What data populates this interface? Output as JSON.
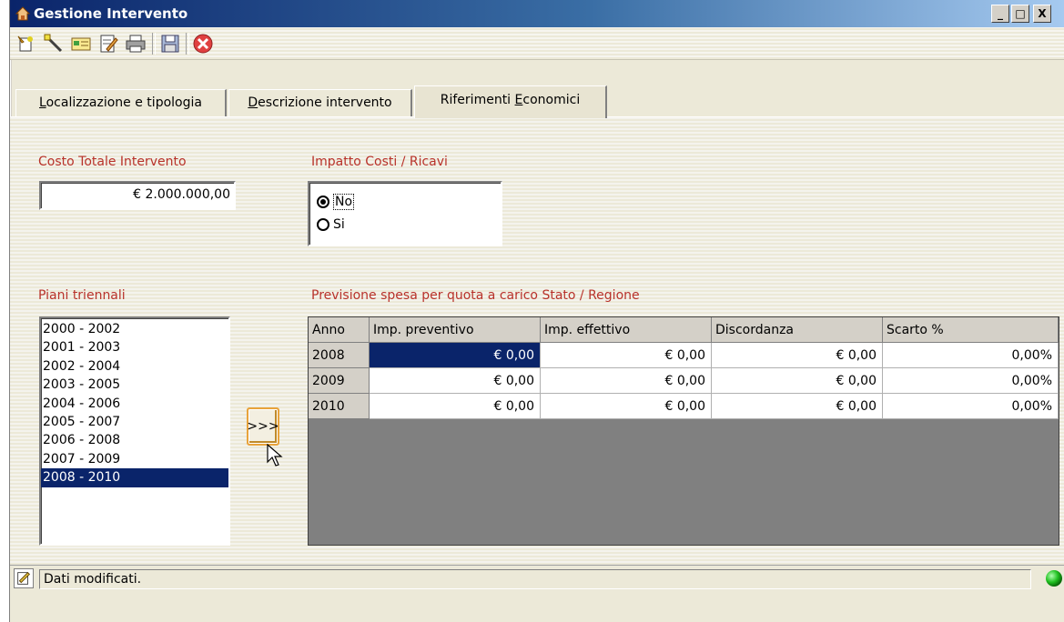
{
  "window": {
    "title": "Gestione Intervento",
    "min_label": "_",
    "max_label": "□",
    "close_label": "X"
  },
  "toolbar": {
    "icons": [
      "new-icon",
      "wand-icon",
      "card-icon",
      "edit-icon",
      "print-icon",
      "save-icon",
      "cancel-icon"
    ]
  },
  "tabs": [
    {
      "label_pre": "",
      "label_ul": "L",
      "label_post": "ocalizzazione e tipologia",
      "active": false
    },
    {
      "label_pre": "",
      "label_ul": "D",
      "label_post": "escrizione intervento",
      "active": false
    },
    {
      "label_pre": "Riferimenti ",
      "label_ul": "E",
      "label_post": "conomici",
      "active": true
    }
  ],
  "costo": {
    "label": "Costo Totale Intervento",
    "value": "€ 2.000.000,00"
  },
  "impatto": {
    "label": "Impatto Costi / Ricavi",
    "options": [
      {
        "label": "No",
        "selected": true
      },
      {
        "label": "Si",
        "selected": false
      }
    ]
  },
  "piani": {
    "label": "Piani triennali",
    "items": [
      "2000 - 2002",
      "2001 - 2003",
      "2002 - 2004",
      "2003 - 2005",
      "2004 - 2006",
      "2005 - 2007",
      "2006 - 2008",
      "2007 - 2009",
      "2008 - 2010"
    ],
    "selected": "2008 - 2010"
  },
  "transfer_button": ">>>",
  "previsione": {
    "label": "Previsione spesa per quota a carico Stato / Regione",
    "columns": [
      "Anno",
      "Imp. preventivo",
      "Imp. effettivo",
      "Discordanza",
      "Scarto %"
    ],
    "rows": [
      [
        "2008",
        "€ 0,00",
        "€ 0,00",
        "€ 0,00",
        "0,00%"
      ],
      [
        "2009",
        "€ 0,00",
        "€ 0,00",
        "€ 0,00",
        "0,00%"
      ],
      [
        "2010",
        "€ 0,00",
        "€ 0,00",
        "€ 0,00",
        "0,00%"
      ]
    ]
  },
  "status": {
    "text": "Dati modificati."
  },
  "colors": {
    "accent_red": "#b8322a",
    "selection": "#0a246a",
    "title_start": "#0a246a",
    "title_end": "#a6caf0"
  }
}
